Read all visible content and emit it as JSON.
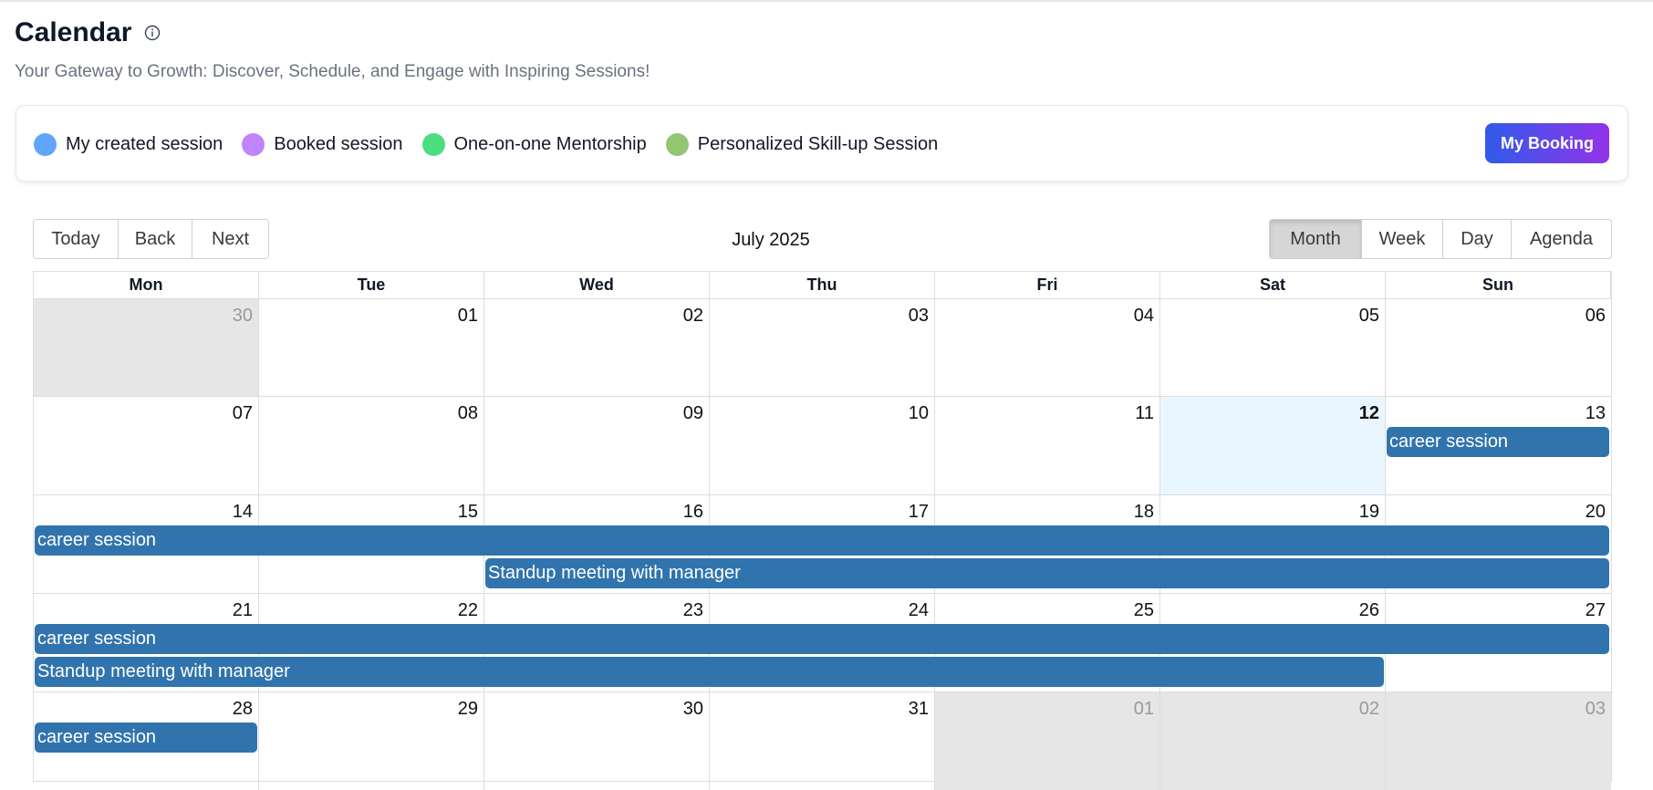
{
  "page": {
    "title": "Calendar",
    "subtitle": "Your Gateway to Growth: Discover, Schedule, and Engage with Inspiring Sessions!"
  },
  "legend": [
    {
      "label": "My created session",
      "color": "#60a5fa"
    },
    {
      "label": "Booked session",
      "color": "#c084fc"
    },
    {
      "label": "One-on-one Mentorship",
      "color": "#4ade80"
    },
    {
      "label": "Personalized Skill-up Session",
      "color": "#93c572"
    }
  ],
  "booking_button": "My Booking",
  "toolbar": {
    "nav": [
      "Today",
      "Back",
      "Next"
    ],
    "label": "July 2025",
    "views": [
      "Month",
      "Week",
      "Day",
      "Agenda"
    ],
    "active_view": "Month"
  },
  "weekdays": [
    "Mon",
    "Tue",
    "Wed",
    "Thu",
    "Fri",
    "Sat",
    "Sun"
  ],
  "weeks": [
    [
      {
        "d": "30",
        "off": true
      },
      {
        "d": "01"
      },
      {
        "d": "02"
      },
      {
        "d": "03"
      },
      {
        "d": "04"
      },
      {
        "d": "05"
      },
      {
        "d": "06"
      }
    ],
    [
      {
        "d": "07"
      },
      {
        "d": "08"
      },
      {
        "d": "09"
      },
      {
        "d": "10"
      },
      {
        "d": "11"
      },
      {
        "d": "12",
        "today": true
      },
      {
        "d": "13"
      }
    ],
    [
      {
        "d": "14"
      },
      {
        "d": "15"
      },
      {
        "d": "16"
      },
      {
        "d": "17"
      },
      {
        "d": "18"
      },
      {
        "d": "19"
      },
      {
        "d": "20"
      }
    ],
    [
      {
        "d": "21"
      },
      {
        "d": "22"
      },
      {
        "d": "23"
      },
      {
        "d": "24"
      },
      {
        "d": "25"
      },
      {
        "d": "26"
      },
      {
        "d": "27"
      }
    ],
    [
      {
        "d": "28"
      },
      {
        "d": "29"
      },
      {
        "d": "30"
      },
      {
        "d": "31"
      },
      {
        "d": "01",
        "off": true
      },
      {
        "d": "02",
        "off": true
      },
      {
        "d": "03",
        "off": true
      }
    ]
  ],
  "events": [
    {
      "title": "career session",
      "week": 1,
      "start": 6,
      "end": 6,
      "slot": 0
    },
    {
      "title": "career session",
      "week": 2,
      "start": 0,
      "end": 6,
      "slot": 0
    },
    {
      "title": "Standup meeting with manager",
      "week": 2,
      "start": 2,
      "end": 6,
      "slot": 1
    },
    {
      "title": "career session",
      "week": 3,
      "start": 0,
      "end": 6,
      "slot": 0
    },
    {
      "title": "Standup meeting with manager",
      "week": 3,
      "start": 0,
      "end": 5,
      "slot": 1
    },
    {
      "title": "career session",
      "week": 4,
      "start": 0,
      "end": 0,
      "slot": 0
    }
  ],
  "icons": {
    "info": "info-circle-icon"
  }
}
